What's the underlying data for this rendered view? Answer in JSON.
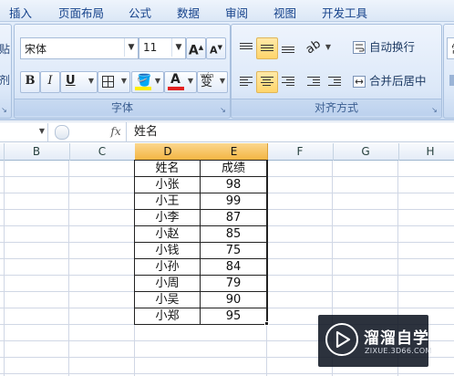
{
  "menu": [
    "插入",
    "页面布局",
    "公式",
    "数据",
    "审阅",
    "视图",
    "开发工具"
  ],
  "font_group": {
    "font_name": "宋体",
    "font_size": "11",
    "bold": "B",
    "italic": "I",
    "underline": "U",
    "font_color_letter": "A",
    "wen_top": "wén",
    "wen_char": "变",
    "label": "字体"
  },
  "alignment_group": {
    "wrap_text": "自动换行",
    "merge_center": "合并后居中",
    "label": "对齐方式"
  },
  "partial_left": {
    "top": "贴",
    "bottom": "剂"
  },
  "partial_right": {
    "top": "常"
  },
  "formula_bar": {
    "fx": "fx",
    "content": "姓名"
  },
  "columns": [
    "B",
    "C",
    "D",
    "E",
    "F",
    "G",
    "H"
  ],
  "table": {
    "headers": [
      "姓名",
      "成绩"
    ],
    "rows": [
      [
        "小张",
        "98"
      ],
      [
        "小王",
        "99"
      ],
      [
        "小李",
        "87"
      ],
      [
        "小赵",
        "85"
      ],
      [
        "小钱",
        "75"
      ],
      [
        "小孙",
        "84"
      ],
      [
        "小周",
        "79"
      ],
      [
        "小吴",
        "90"
      ],
      [
        "小郑",
        "95"
      ]
    ]
  },
  "colors": {
    "ribbon_text": "#15428b",
    "selected_header": "#f3b33f",
    "font_color_bar": "#e32020",
    "highlight_bar": "#ffee00"
  },
  "watermark": {
    "title": "溜溜自学",
    "subtitle": "ZIXUE.3D66.COM"
  }
}
